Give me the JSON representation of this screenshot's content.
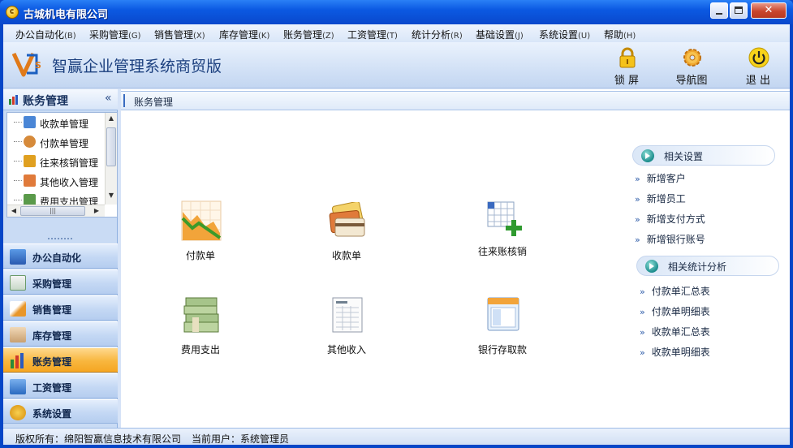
{
  "window": {
    "title": "古城机电有限公司"
  },
  "menu": [
    {
      "label": "办公自动化",
      "hotkey": "(B)"
    },
    {
      "label": "采购管理",
      "hotkey": "(G)"
    },
    {
      "label": "销售管理",
      "hotkey": "(X)"
    },
    {
      "label": "库存管理",
      "hotkey": "(K)"
    },
    {
      "label": "账务管理",
      "hotkey": "(Z)"
    },
    {
      "label": "工资管理",
      "hotkey": "(T)"
    },
    {
      "label": "统计分析",
      "hotkey": "(R)"
    },
    {
      "label": "基础设置",
      "hotkey": "(J)"
    },
    {
      "label": "系统设置",
      "hotkey": "(U)"
    },
    {
      "label": "帮助",
      "hotkey": "(H)"
    }
  ],
  "toolbar": {
    "app_title": "智赢企业管理系统商贸版",
    "lock_label": "锁 屏",
    "nav_label": "导航图",
    "exit_label": "退 出"
  },
  "sidebar": {
    "title": "账务管理",
    "collapse_glyph": "«",
    "tree": [
      {
        "label": "收款单管理",
        "icon": "receipt-icon",
        "color": "#4a86d6"
      },
      {
        "label": "付款单管理",
        "icon": "person-icon",
        "color": "#d68a3a"
      },
      {
        "label": "往来核销管理",
        "icon": "grid-icon",
        "color": "#e0a020"
      },
      {
        "label": "其他收入管理",
        "icon": "envelope-icon",
        "color": "#e07a3a"
      },
      {
        "label": "费用支出管理",
        "icon": "money-icon",
        "color": "#5a9a4a"
      }
    ],
    "nav": [
      {
        "label": "办公自动化",
        "icon": "monitor-icon",
        "color": "#3b78c8",
        "active": false
      },
      {
        "label": "采购管理",
        "icon": "checklist-icon",
        "color": "#4a9a5a",
        "active": false
      },
      {
        "label": "销售管理",
        "icon": "pencil-icon",
        "color": "#d98a2a",
        "active": false
      },
      {
        "label": "库存管理",
        "icon": "hand-icon",
        "color": "#c9a070",
        "active": false
      },
      {
        "label": "账务管理",
        "icon": "chart-icon",
        "color": "#2a8a3a",
        "active": true
      },
      {
        "label": "工资管理",
        "icon": "card-icon",
        "color": "#3b78c8",
        "active": false
      },
      {
        "label": "系统设置",
        "icon": "gear-icon",
        "color": "#e0a020",
        "active": false
      }
    ]
  },
  "main": {
    "breadcrumb": "账务管理",
    "icons": [
      {
        "label": "付款单",
        "icon": "chart-down-icon"
      },
      {
        "label": "收款单",
        "icon": "credit-cards-icon"
      },
      {
        "label": "往来账核销",
        "icon": "table-add-icon"
      },
      {
        "label": "费用支出",
        "icon": "cash-stack-icon"
      },
      {
        "label": "其他收入",
        "icon": "document-icon"
      },
      {
        "label": "银行存取款",
        "icon": "window-icon"
      }
    ],
    "related_settings": {
      "title": "相关设置",
      "links": [
        "新增客户",
        "新增员工",
        "新增支付方式",
        "新增银行账号"
      ]
    },
    "related_stats": {
      "title": "相关统计分析",
      "links": [
        "付款单汇总表",
        "付款单明细表",
        "收款单汇总表",
        "收款单明细表"
      ]
    }
  },
  "status": {
    "copyright": "版权所有：绵阳智赢信息技术有限公司",
    "user": "当前用户：系统管理员"
  },
  "colors": {
    "titlebar": "#0a59e2",
    "active_nav": "#f8b63e",
    "accent": "#1b3f7e"
  }
}
